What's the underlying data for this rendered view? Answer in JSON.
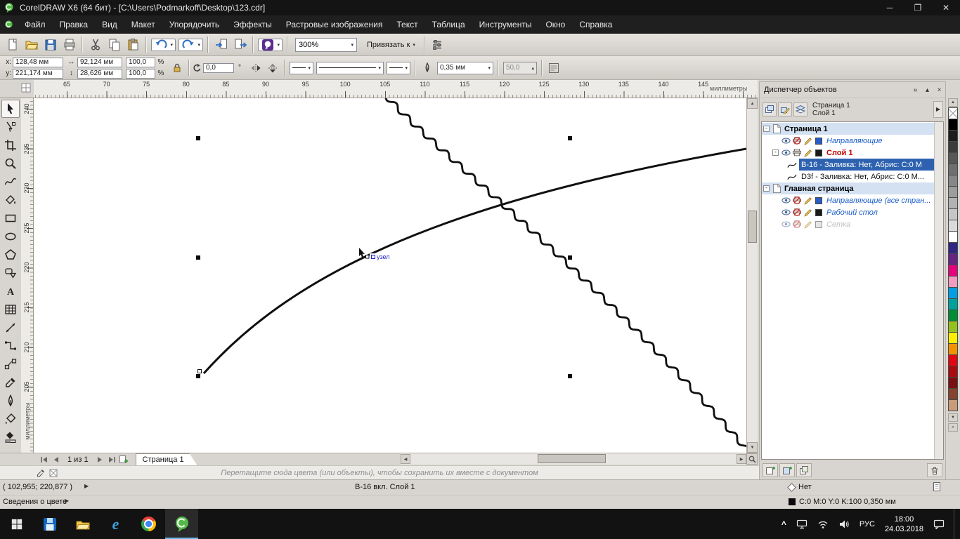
{
  "titlebar": {
    "title": "CorelDRAW X6 (64 бит) - [C:\\Users\\Podmarkoff\\Desktop\\123.cdr]"
  },
  "menu": {
    "items": [
      "Файл",
      "Правка",
      "Вид",
      "Макет",
      "Упорядочить",
      "Эффекты",
      "Растровые изображения",
      "Текст",
      "Таблица",
      "Инструменты",
      "Окно",
      "Справка"
    ]
  },
  "toolbar_std": {
    "buttons": [
      {
        "name": "new-document",
        "icon": "new"
      },
      {
        "name": "open",
        "icon": "open"
      },
      {
        "name": "save",
        "icon": "save"
      },
      {
        "name": "print",
        "icon": "print"
      },
      {
        "name": "sep"
      },
      {
        "name": "cut",
        "icon": "cut"
      },
      {
        "name": "copy",
        "icon": "copy"
      },
      {
        "name": "paste",
        "icon": "paste"
      },
      {
        "name": "sep"
      },
      {
        "name": "undo",
        "icon": "undo",
        "dropdown": true
      },
      {
        "name": "redo",
        "icon": "redo",
        "dropdown": true
      },
      {
        "name": "sep"
      },
      {
        "name": "import",
        "icon": "import"
      },
      {
        "name": "export",
        "icon": "export"
      },
      {
        "name": "sep"
      },
      {
        "name": "application-launcher",
        "icon": "launcher",
        "dropdown": true
      },
      {
        "name": "sep"
      }
    ],
    "zoom_value": "300%",
    "snap_label": "Привязать к"
  },
  "property_bar": {
    "x_label": "x:",
    "x_value": "128,48 мм",
    "y_label": "y:",
    "y_value": "221,174 мм",
    "width_value": "92,124 мм",
    "height_value": "28,626 мм",
    "scale_x": "100,0",
    "scale_y": "100,0",
    "percent": "%",
    "angle_value": "0,0",
    "angle_unit": "°",
    "outline_width": "0,35 мм",
    "smoothing": "50,0"
  },
  "ruler": {
    "h_numbers": [
      65,
      70,
      75,
      80,
      85,
      90,
      95,
      100,
      105,
      110,
      115,
      120,
      125,
      130,
      135,
      140,
      145
    ],
    "h_unit": "миллиметры",
    "v_numbers": [
      240,
      235,
      230,
      225,
      220,
      215,
      210,
      205
    ],
    "v_unit": "миллиметры"
  },
  "toolbox": {
    "tools": [
      {
        "name": "pick",
        "active": true
      },
      {
        "name": "shape"
      },
      {
        "name": "crop"
      },
      {
        "name": "zoom"
      },
      {
        "name": "freehand"
      },
      {
        "name": "smart-fill"
      },
      {
        "name": "rectangle"
      },
      {
        "name": "ellipse"
      },
      {
        "name": "polygon"
      },
      {
        "name": "basic-shapes"
      },
      {
        "name": "text"
      },
      {
        "name": "table"
      },
      {
        "name": "dimension"
      },
      {
        "name": "connector"
      },
      {
        "name": "blend"
      },
      {
        "name": "eyedropper"
      },
      {
        "name": "outline-pen"
      },
      {
        "name": "fill"
      },
      {
        "name": "interactive-fill"
      }
    ]
  },
  "canvas": {
    "node_tooltip": "узел"
  },
  "docker": {
    "title": "Диспетчер объектов",
    "page_label": "Страница 1",
    "layer_label": "Слой 1",
    "tree": [
      {
        "kind": "page",
        "label": "Страница 1",
        "expanded": true
      },
      {
        "kind": "layer",
        "label": "Направляющие",
        "italic": true,
        "color": "#1a5dc8",
        "swatch": "#2a5cc8",
        "noprint": true
      },
      {
        "kind": "layer",
        "label": "Слой 1",
        "bold": true,
        "color": "#c00000",
        "swatch": "#1a1a1a",
        "expanded": true
      },
      {
        "kind": "object",
        "label": "B-16 - Заливка: Нет, Абрис: C:0 M",
        "selected": true
      },
      {
        "kind": "object",
        "label": "D3f - Заливка: Нет, Абрис: C:0 M..."
      },
      {
        "kind": "page",
        "label": "Главная страница",
        "expanded": true
      },
      {
        "kind": "layer",
        "label": "Направляющие (все стран...",
        "italic": true,
        "color": "#1a5dc8",
        "swatch": "#2a5cc8",
        "noprint": true
      },
      {
        "kind": "layer",
        "label": "Рабочий стол",
        "italic": true,
        "color": "#1a5dc8",
        "swatch": "#1a1a1a",
        "noprint": true
      },
      {
        "kind": "layer",
        "label": "Сетка",
        "italic": true,
        "color": "#8a8a8a",
        "swatch": "#d0d0d0",
        "noprint": true,
        "dim": true
      }
    ]
  },
  "palette": {
    "colors": [
      "none",
      "#000000",
      "#1d1d1b",
      "#3c3c3b",
      "#575756",
      "#706f6f",
      "#878787",
      "#9d9d9c",
      "#b2b2b2",
      "#c6c6c6",
      "#dadada",
      "#ffffff",
      "#312783",
      "#662483",
      "#e6007e",
      "#f39ac1",
      "#009fe3",
      "#00a19a",
      "#008d36",
      "#95c11f",
      "#ffed00",
      "#f39200",
      "#e30613",
      "#a80c0f",
      "#7b1012",
      "#86432e",
      "#c89b7b"
    ]
  },
  "navigator": {
    "page_counter": "1 из 1",
    "tab_label": "Страница 1"
  },
  "dragbar": {
    "text": "Перетащите сюда цвета (или объекты), чтобы сохранить их вместе с документом"
  },
  "status": {
    "coords": "( 102,955; 220,877 )",
    "object_info": "B-16 вкл. Слой 1",
    "color_info_label": "Сведения о цвете",
    "fill_label": "Нет",
    "outline_text": "C:0 M:0 Y:0 K:100  0,350 мм"
  },
  "taskbar": {
    "apps": [
      {
        "name": "disk-app"
      },
      {
        "name": "explorer"
      },
      {
        "name": "edge"
      },
      {
        "name": "chrome"
      },
      {
        "name": "coreldraw",
        "active": true
      }
    ],
    "lang": "РУС",
    "time": "18:00",
    "date": "24.03.2018"
  }
}
